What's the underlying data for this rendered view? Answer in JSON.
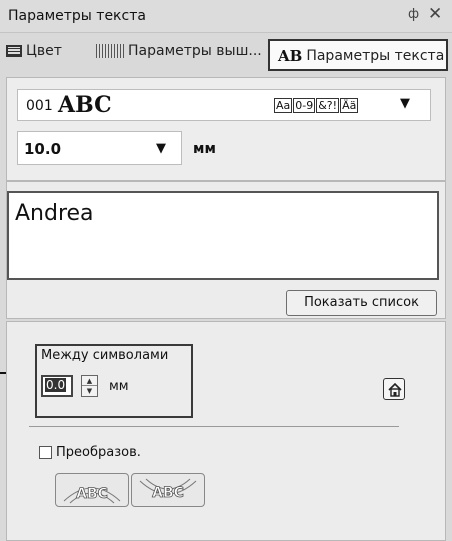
{
  "titlebar": {
    "title": "Параметры текста",
    "pin": "ф",
    "close": "✕"
  },
  "tabs": [
    {
      "label": "Цвет",
      "icon": "monitor-icon"
    },
    {
      "label": "Параметры выш...",
      "icon": "stitch-icon"
    },
    {
      "label": "Параметры текста",
      "icon": "ab-icon",
      "icon_text": "AB",
      "active": true
    }
  ],
  "font": {
    "number": "001",
    "sample": "ABC",
    "charset": [
      "Aa",
      "0-9",
      "&?!",
      "Ää"
    ],
    "arrow": "▼"
  },
  "size": {
    "value": "10.0",
    "unit": "мм",
    "arrow": "▼"
  },
  "text_entry": {
    "value": "Andrea"
  },
  "show_list_button": "Показать список",
  "spacing": {
    "label": "Между символами",
    "value": "0.0",
    "unit": "мм"
  },
  "transform": {
    "label": "Преобразов.",
    "checked": false
  },
  "arc_buttons": [
    {
      "text": "ABC",
      "icon": "arc-up-icon"
    },
    {
      "text": "ABC",
      "icon": "arc-down-icon"
    }
  ],
  "colors": {
    "panel_bg": "#d9d9d9",
    "section_bg": "#ececec",
    "border_dark": "#333333"
  }
}
